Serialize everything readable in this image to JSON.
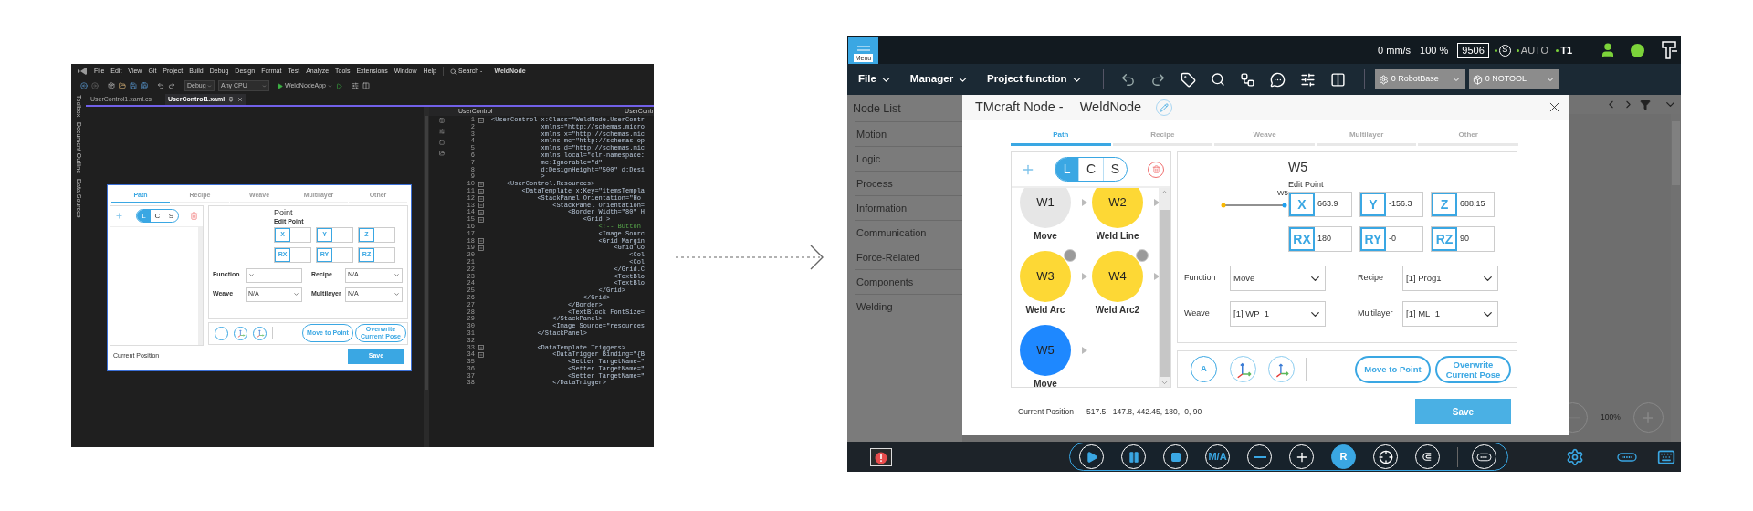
{
  "vs_window": {
    "menu": [
      "File",
      "Edit",
      "View",
      "Git",
      "Project",
      "Build",
      "Debug",
      "Design",
      "Format",
      "Test",
      "Analyze",
      "Tools",
      "Extensions",
      "Window",
      "Help"
    ],
    "search": "Search -",
    "solution_name": "WeldNode",
    "toolbar": {
      "configuration": "Debug",
      "platform": "Any CPU",
      "startup_project": "WeldNodeApp"
    },
    "tabs": [
      {
        "label": "UserControl1.xaml.cs",
        "selected": false
      },
      {
        "label": "UserControl1.xaml",
        "selected": true
      }
    ],
    "side_tabs": [
      "Toolbox",
      "Document Outline",
      "Data Sources"
    ],
    "designer_preview": {
      "tabs": [
        {
          "label": "Path",
          "selected": true
        },
        {
          "label": "Recipe",
          "selected": false
        },
        {
          "label": "Weave",
          "selected": false
        },
        {
          "label": "Multilayer",
          "selected": false
        },
        {
          "label": "Other",
          "selected": false
        }
      ],
      "segments": [
        {
          "label": "L",
          "selected": true
        },
        {
          "label": "C",
          "selected": false
        },
        {
          "label": "S",
          "selected": false
        }
      ],
      "title": "Point",
      "edit_label": "Edit Point",
      "coords": [
        {
          "axis": "X"
        },
        {
          "axis": "Y"
        },
        {
          "axis": "Z"
        },
        {
          "axis": "RX"
        },
        {
          "axis": "RY"
        },
        {
          "axis": "RZ"
        }
      ],
      "params": [
        {
          "label": "Function"
        },
        {
          "label": "Recipe",
          "value": "N/A"
        },
        {
          "label": "Weave",
          "value": "N/A"
        },
        {
          "label": "Multilayer",
          "value": "N/A"
        }
      ],
      "action_buttons": [
        "Move to Point",
        "Overwrite Current Pose"
      ],
      "current_position_label": "Current Position",
      "save": "Save"
    },
    "editor": {
      "scope_left": "UserControl",
      "scope_right": "UserContr",
      "lines": [
        {
          "number": "1",
          "text": "<UserControl x:Class=\"WeldNode.UserContr",
          "kind": "code",
          "fold": true
        },
        {
          "number": "2",
          "text": "             xmlns=\"http://schemas.micro",
          "kind": "code",
          "fold": false
        },
        {
          "number": "3",
          "text": "             xmlns:x=\"http://schemas.mic",
          "kind": "code",
          "fold": false
        },
        {
          "number": "4",
          "text": "             xmlns:mc=\"http://schemas.op",
          "kind": "code",
          "fold": false
        },
        {
          "number": "5",
          "text": "             xmlns:d=\"http://schemas.mic",
          "kind": "code",
          "fold": false
        },
        {
          "number": "6",
          "text": "             xmlns:local=\"clr-namespace:",
          "kind": "code",
          "fold": false
        },
        {
          "number": "7",
          "text": "             mc:Ignorable=\"d\"",
          "kind": "code",
          "fold": false
        },
        {
          "number": "8",
          "text": "             d:DesignHeight=\"500\" d:Desi",
          "kind": "code",
          "fold": false
        },
        {
          "number": "9",
          "text": "             >",
          "kind": "code",
          "fold": false
        },
        {
          "number": "10",
          "text": "    <UserControl.Resources>",
          "kind": "code",
          "fold": true
        },
        {
          "number": "11",
          "text": "        <DataTemplate x:Key=\"itemsTempla",
          "kind": "code",
          "fold": true
        },
        {
          "number": "12",
          "text": "            <StackPanel Orientation=\"Ho",
          "kind": "code",
          "fold": true
        },
        {
          "number": "13",
          "text": "                <StackPanel Orientation=",
          "kind": "code",
          "fold": true
        },
        {
          "number": "14",
          "text": "                    <Border Width=\"80\" H",
          "kind": "code",
          "fold": true
        },
        {
          "number": "15",
          "text": "                        <Grid >",
          "kind": "code",
          "fold": true
        },
        {
          "number": "16",
          "text": "                            <!-- Button",
          "kind": "comment",
          "fold": false
        },
        {
          "number": "17",
          "text": "                            <Image Sourc",
          "kind": "code",
          "fold": false
        },
        {
          "number": "18",
          "text": "                            <Grid Margin",
          "kind": "code",
          "fold": true
        },
        {
          "number": "19",
          "text": "                                <Grid.Co",
          "kind": "code",
          "fold": true
        },
        {
          "number": "20",
          "text": "                                    <Col",
          "kind": "code",
          "fold": false
        },
        {
          "number": "21",
          "text": "                                    <Col",
          "kind": "code",
          "fold": false
        },
        {
          "number": "22",
          "text": "                                </Grid.C",
          "kind": "code",
          "fold": false
        },
        {
          "number": "23",
          "text": "                                <TextBlo",
          "kind": "code",
          "fold": false
        },
        {
          "number": "24",
          "text": "                                <TextBlo",
          "kind": "code",
          "fold": false
        },
        {
          "number": "25",
          "text": "                            </Grid>",
          "kind": "code",
          "fold": false
        },
        {
          "number": "26",
          "text": "                        </Grid>",
          "kind": "code",
          "fold": false
        },
        {
          "number": "27",
          "text": "                    </Border>",
          "kind": "code",
          "fold": false
        },
        {
          "number": "28",
          "text": "                    <TextBlock FontSize=",
          "kind": "code",
          "fold": false
        },
        {
          "number": "29",
          "text": "                </StackPanel>",
          "kind": "code",
          "fold": false
        },
        {
          "number": "30",
          "text": "                <Image Source=\"resources",
          "kind": "code",
          "fold": false
        },
        {
          "number": "31",
          "text": "            </StackPanel>",
          "kind": "code",
          "fold": false
        },
        {
          "number": "32",
          "fold": false
        },
        {
          "number": "33",
          "text": "            <DataTemplate.Triggers>",
          "kind": "code",
          "fold": true
        },
        {
          "number": "34",
          "text": "                <DataTrigger Binding=\"{B",
          "kind": "code",
          "fold": true
        },
        {
          "number": "35",
          "text": "                    <Setter TargetName=\"",
          "kind": "code",
          "fold": false
        },
        {
          "number": "36",
          "text": "                    <Setter TargetName=\"",
          "kind": "code",
          "fold": false
        },
        {
          "number": "37",
          "text": "                    <Setter TargetName=\"",
          "kind": "code",
          "fold": false
        },
        {
          "number": "38",
          "text": "                </DataTrigger>",
          "kind": "code",
          "fold": false
        }
      ]
    }
  },
  "tmflow": {
    "top_bar": {
      "menu_button": "Menu",
      "speed": "0 mm/s",
      "percent": "100 %",
      "counter": "9506",
      "safety": "S",
      "mode": "AUTO",
      "level": "T1"
    },
    "menu_bar": {
      "menus": [
        "File",
        "Manager",
        "Project function"
      ],
      "base_select": "0 RobotBase",
      "tool_select": "0 NOTOOL"
    },
    "node_list": {
      "title": "Node List",
      "items": [
        "Motion",
        "Logic",
        "Process",
        "Information",
        "Communication",
        "Force-Related",
        "Components",
        "Welding"
      ]
    },
    "dialog": {
      "title": "TMcraft Node -",
      "node_name": "WeldNode",
      "tabs": [
        {
          "label": "Path",
          "selected": true
        },
        {
          "label": "Recipe",
          "selected": false
        },
        {
          "label": "Weave",
          "selected": false
        },
        {
          "label": "Multilayer",
          "selected": false
        },
        {
          "label": "Other",
          "selected": false
        }
      ],
      "segments": [
        {
          "label": "L",
          "selected": true
        },
        {
          "label": "C",
          "selected": false
        },
        {
          "label": "S",
          "selected": false
        }
      ],
      "nodes": [
        {
          "id": "W1",
          "label": "Move",
          "color": "#e6e6e6"
        },
        {
          "id": "W2",
          "label": "Weld Line",
          "color": "#fdd835"
        },
        {
          "id": "W3",
          "label": "Weld Arc",
          "color": "#fdd835",
          "badge": true
        },
        {
          "id": "W4",
          "label": "Weld Arc2",
          "color": "#fdd835",
          "badge": true
        },
        {
          "id": "W5",
          "label": "Move",
          "color": "#1e88ff",
          "badge": false
        }
      ],
      "point_title": "W5",
      "diagram_label": "W5",
      "edit_label": "Edit Point",
      "coords": [
        {
          "axis": "X",
          "value": "663.9"
        },
        {
          "axis": "Y",
          "value": "-156.3"
        },
        {
          "axis": "Z",
          "value": "688.15"
        },
        {
          "axis": "RX",
          "value": "180"
        },
        {
          "axis": "RY",
          "value": "-0"
        },
        {
          "axis": "RZ",
          "value": "90"
        }
      ],
      "params": [
        {
          "label": "Function",
          "value": "Move"
        },
        {
          "label": "Recipe",
          "value": "[1] Prog1"
        },
        {
          "label": "Weave",
          "value": "[1] WP_1"
        },
        {
          "label": "Multilayer",
          "value": "[1] ML_1"
        }
      ],
      "tool_buttons": [
        "A"
      ],
      "action_buttons": [
        "Move to Point",
        "Overwrite Current Pose"
      ],
      "current_position_label": "Current Position",
      "current_position": "517.5, -147.8, 442.45, 180, -0, 90",
      "save": "Save"
    },
    "canvas": {
      "zoom": "100%"
    },
    "bottom_bar": {
      "controls": [
        {
          "kind": "play",
          "on": false
        },
        {
          "kind": "pause",
          "on": false
        },
        {
          "kind": "stop",
          "on": false
        },
        {
          "kind": "text",
          "label": "M/A",
          "on": false
        },
        {
          "kind": "minus",
          "on": false
        },
        {
          "kind": "plus",
          "on": false
        },
        {
          "kind": "text",
          "label": "R",
          "on": true
        },
        {
          "kind": "target",
          "on": false
        },
        {
          "kind": "hook",
          "on": false
        }
      ]
    }
  }
}
